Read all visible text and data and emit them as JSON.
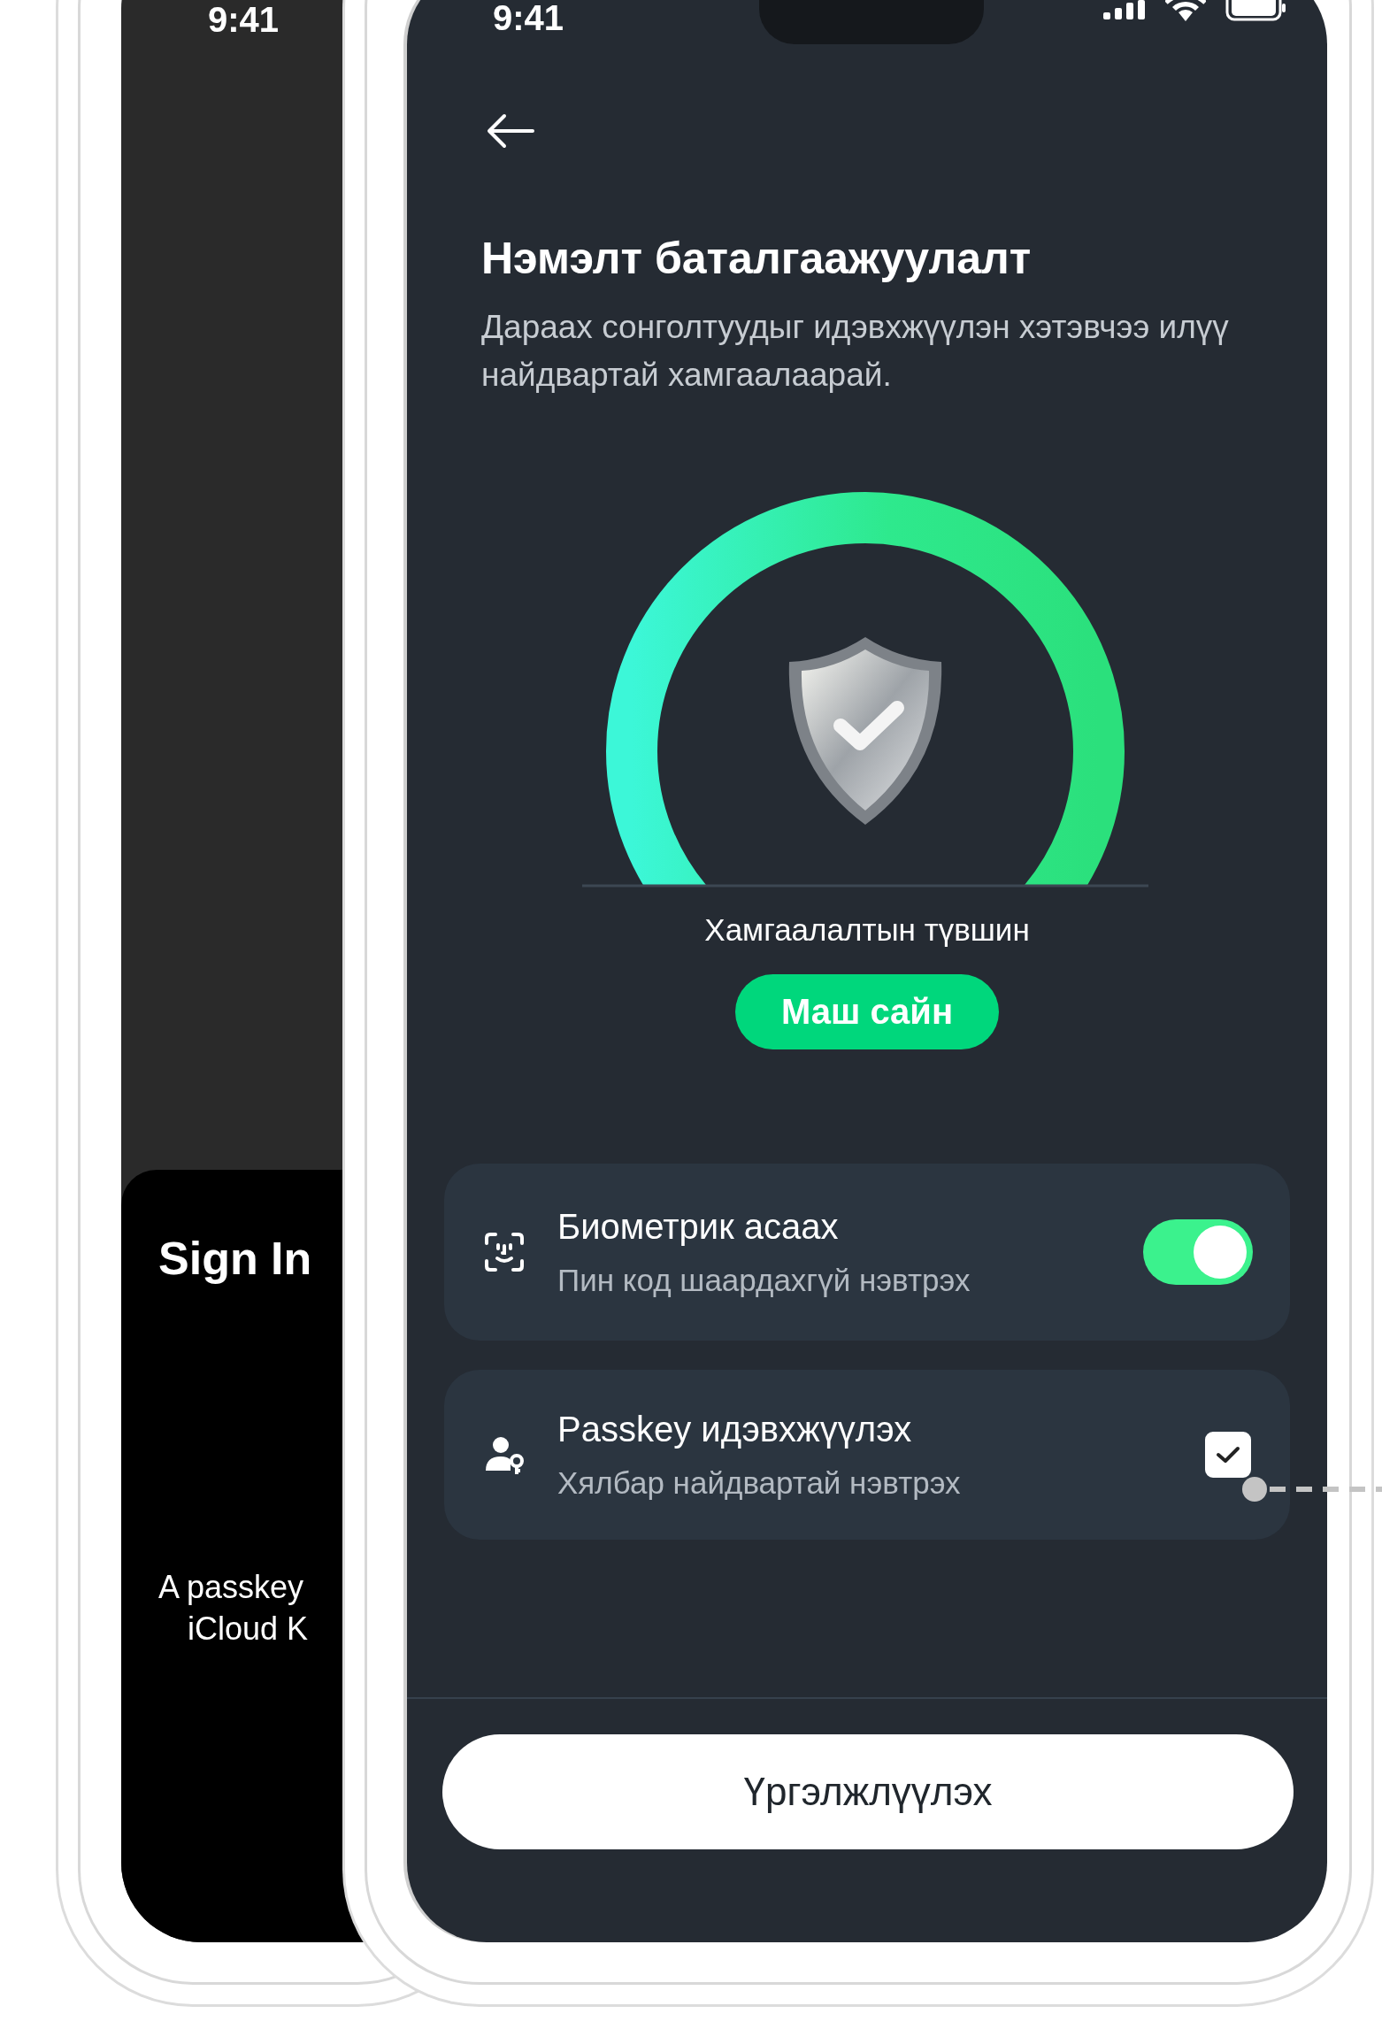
{
  "back_phone": {
    "status_time": "9:41",
    "title": "Sign In",
    "lines": [
      "A passkey",
      "iCloud K"
    ]
  },
  "front_phone": {
    "status_time": "9:41",
    "title": "Нэмэлт баталгаажуулалт",
    "subtitle": "Дараах сонголтуудыг идэвхжүүлэн хэтэвчээ илүү найдвартай хамгаалаарай.",
    "gauge_label": "Хамгаалалтын түвшин",
    "level_badge": "Маш сайн",
    "options": [
      {
        "kind": "toggle",
        "title": "Биометрик асаах",
        "subtitle": "Пин код шаардахгүй нэвтрэх",
        "on": true
      },
      {
        "kind": "checkbox",
        "title": "Passkey идэвхжүүлэх",
        "subtitle": "Хялбар найдвартай нэвтрэх",
        "checked": true
      }
    ],
    "continue_button": "Үргэлжлүүлэх"
  }
}
